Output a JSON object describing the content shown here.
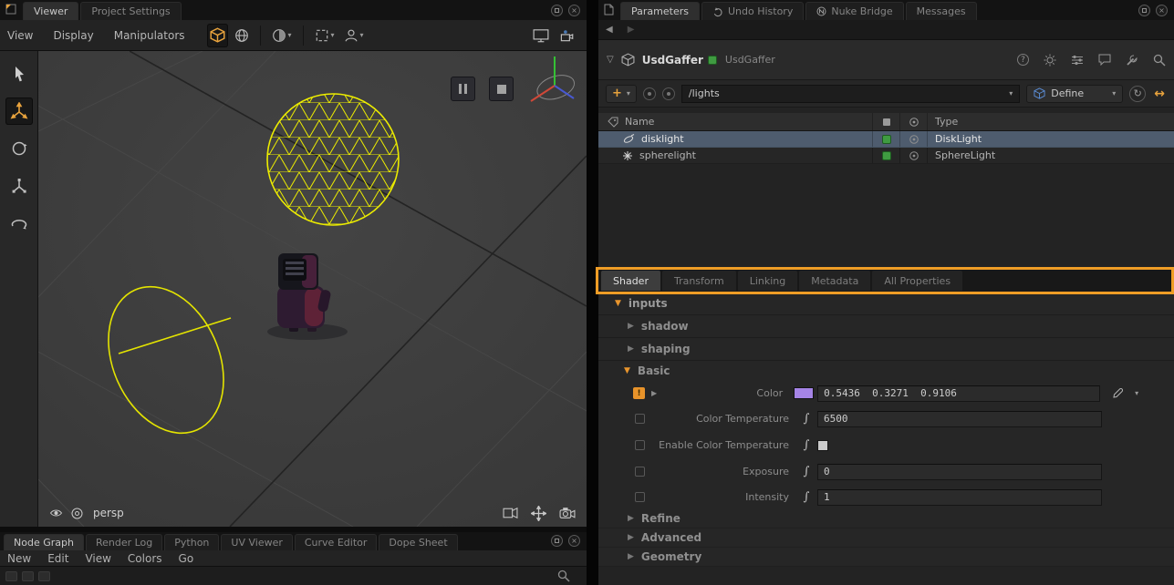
{
  "colors": {
    "accent_orange": "#e8a33d",
    "annotation_orange": "#ef9d26",
    "selection_blue": "#4e5c6e",
    "badge_green": "#3f9b41",
    "wire_yellow": "#ecec00"
  },
  "glyphs": {
    "tri_open": "▼",
    "tri_closed": "▶",
    "caret": "▾",
    "back": "◀",
    "forward": "▶",
    "close": "×",
    "disclosure": "▽",
    "integral": "∫",
    "refresh": "↻",
    "swap": "↔",
    "question": "?",
    "warn": "!"
  },
  "viewer": {
    "tabs": [
      {
        "label": "Viewer"
      },
      {
        "label": "Project Settings"
      }
    ],
    "menus": [
      {
        "label": "View"
      },
      {
        "label": "Display"
      },
      {
        "label": "Manipulators"
      }
    ],
    "camera_label": "persp"
  },
  "bottom": {
    "tabs": [
      {
        "label": "Node Graph"
      },
      {
        "label": "Render Log"
      },
      {
        "label": "Python"
      },
      {
        "label": "UV Viewer"
      },
      {
        "label": "Curve Editor"
      },
      {
        "label": "Dope Sheet"
      }
    ],
    "menus": [
      {
        "label": "New"
      },
      {
        "label": "Edit"
      },
      {
        "label": "View"
      },
      {
        "label": "Colors"
      },
      {
        "label": "Go"
      }
    ]
  },
  "params": {
    "tabs": [
      {
        "label": "Parameters"
      },
      {
        "label": "Undo History"
      },
      {
        "label": "Nuke Bridge"
      },
      {
        "label": "Messages"
      }
    ],
    "node": {
      "title": "UsdGaffer",
      "type_label": "UsdGaffer"
    },
    "toolbar": {
      "add_label": "+",
      "path_value": "/lights",
      "define_label": "Define"
    },
    "table": {
      "name_header": "Name",
      "type_header": "Type",
      "rows": [
        {
          "name": "disklight",
          "type": "DiskLight"
        },
        {
          "name": "spherelight",
          "type": "SphereLight"
        }
      ]
    },
    "prop_tabs": [
      {
        "label": "Shader"
      },
      {
        "label": "Transform"
      },
      {
        "label": "Linking"
      },
      {
        "label": "Metadata"
      },
      {
        "label": "All Properties"
      }
    ],
    "sections": {
      "inputs": "inputs",
      "shadow": "shadow",
      "shaping": "shaping",
      "basic": "Basic",
      "refine": "Refine",
      "advanced": "Advanced",
      "geometry": "Geometry"
    },
    "fields": {
      "color": {
        "label": "Color",
        "value": "0.5436  0.3271  0.9106",
        "swatch": "#a584e6"
      },
      "color_temperature": {
        "label": "Color Temperature",
        "value": "6500"
      },
      "enable_color_temperature": {
        "label": "Enable Color Temperature"
      },
      "exposure": {
        "label": "Exposure",
        "value": "0"
      },
      "intensity": {
        "label": "Intensity",
        "value": "1"
      }
    }
  }
}
